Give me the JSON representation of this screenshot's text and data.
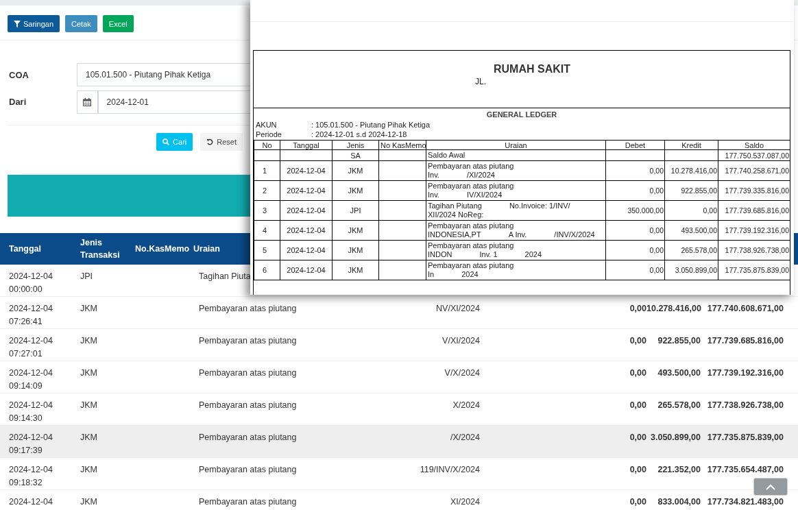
{
  "toolbar": {
    "buttons": [
      {
        "label": "Saringan",
        "kind": "filter"
      },
      {
        "label": "Cetak",
        "kind": "print"
      },
      {
        "label": "Excel",
        "kind": "excel"
      }
    ]
  },
  "filter": {
    "fields": [
      {
        "label": "COA",
        "value": "105.01.500 - Piutang Pihak Ketiga",
        "kind": "select"
      },
      {
        "label": "Dari",
        "value": "2024-12-01",
        "kind": "date"
      }
    ],
    "buttons": [
      {
        "label": "Cari",
        "kind": "search"
      },
      {
        "label": "Reset",
        "kind": "reset"
      }
    ]
  },
  "table": {
    "columns": [
      "Tanggal",
      "Jenis Transaksi",
      "No.KasMemo",
      "Uraian"
    ],
    "rows": [
      {
        "date": "2024-12-04",
        "time": "00:00:00",
        "jenis": "JPI",
        "uraian": "Tagihan Piuta",
        "highlighted": false
      },
      {
        "date": "2024-12-04",
        "time": "07:26:41",
        "jenis": "JKM",
        "uraian": "Pembayaran atas piutang",
        "tail": "NV/XI/2024",
        "debet": "0,00",
        "kredit": "10.278.416,00",
        "saldo": "177.740.608.671,00",
        "highlighted": false
      },
      {
        "date": "2024-12-04",
        "time": "07:27:01",
        "jenis": "JKM",
        "uraian": "Pembayaran atas piutang",
        "tail": "V/XI/2024",
        "debet": "0,00",
        "kredit": "922.855,00",
        "saldo": "177.739.685.816,00",
        "highlighted": false
      },
      {
        "date": "2024-12-04",
        "time": "09:14:09",
        "jenis": "JKM",
        "uraian": "Pembayaran atas piutang",
        "tail": "V/X/2024",
        "debet": "0,00",
        "kredit": "493.500,00",
        "saldo": "177.739.192.316,00",
        "highlighted": false
      },
      {
        "date": "2024-12-04",
        "time": "09:14:30",
        "jenis": "JKM",
        "uraian": "Pembayaran atas piutang",
        "tail": "X/2024",
        "debet": "0,00",
        "kredit": "265.578,00",
        "saldo": "177.738.926.738,00",
        "highlighted": false
      },
      {
        "date": "2024-12-04",
        "time": "09:17:39",
        "jenis": "JKM",
        "uraian": "Pembayaran atas piutang",
        "tail": "/X/2024",
        "debet": "0,00",
        "kredit": "3.050.899,00",
        "saldo": "177.735.875.839,00",
        "highlighted": true
      },
      {
        "date": "2024-12-04",
        "time": "09:18:32",
        "jenis": "JKM",
        "uraian": "Pembayaran atas piutang",
        "tail": "119/INV/X/2024",
        "debet": "0,00",
        "kredit": "221.352,00",
        "saldo": "177.735.654.487,00",
        "highlighted": false
      },
      {
        "date": "2024-12-04",
        "jenis": "JKM",
        "uraian": "Pembayaran atas piutang",
        "tail": "XI/2024",
        "debet": "0,00",
        "kredit": "833.004,00",
        "saldo": "177.734.821.483,00",
        "highlighted": false
      }
    ]
  },
  "report": {
    "title": "RUMAH SAKIT",
    "address": "JL.",
    "heading": "GENERAL LEDGER",
    "meta": [
      {
        "label": "AKUN",
        "value": ": 105.01.500 - Piutang Pihak Ketiga"
      },
      {
        "label": "Periode",
        "value": ": 2024-12-01 s.d 2024-12-18"
      }
    ],
    "columns": [
      "No",
      "Tanggal",
      "Jenis",
      "No KasMemo",
      "Uraian",
      "Debet",
      "Kredit",
      "Saldo"
    ],
    "rows": [
      {
        "jenis": "SA",
        "lines": [
          [
            "Saldo Awal"
          ]
        ],
        "saldo": "177.750.537.087,00"
      },
      {
        "no": "1",
        "tanggal": "2024-12-04",
        "jenis": "JKM",
        "lines": [
          [
            "Pembayaran atas piutang"
          ],
          [
            "Inv.",
            "/XI/2024"
          ]
        ],
        "debet": "0,00",
        "kredit": "10.278.416,00",
        "saldo": "177.740.258.671,00"
      },
      {
        "no": "2",
        "tanggal": "2024-12-04",
        "jenis": "JKM",
        "lines": [
          [
            "Pembayaran atas piutang"
          ],
          [
            "Inv.",
            "IV/XI/2024"
          ]
        ],
        "debet": "0,00",
        "kredit": "922.855,00",
        "saldo": "177.739.335.816,00"
      },
      {
        "no": "3",
        "tanggal": "2024-12-04",
        "jenis": "JPI",
        "lines": [
          [
            "Tagihan Piutang",
            "No.Invoice: 1/INV/"
          ],
          [
            "XII/2024 NoReg:"
          ]
        ],
        "debet": "350.000,00",
        "kredit": "0,00",
        "saldo": "177.739.685.816,00"
      },
      {
        "no": "4",
        "tanggal": "2024-12-04",
        "jenis": "JKM",
        "lines": [
          [
            "Pembayaran atas piutang"
          ],
          [
            "INDONESIA,PT",
            "A Inv.",
            "/INV/X/2024"
          ]
        ],
        "debet": "0,00",
        "kredit": "493.500,00",
        "saldo": "177.739.192.316,00"
      },
      {
        "no": "5",
        "tanggal": "2024-12-04",
        "jenis": "JKM",
        "lines": [
          [
            "Pembayaran atas piutang"
          ],
          [
            "INDON",
            "Inv. 1",
            "2024"
          ]
        ],
        "debet": "0,00",
        "kredit": "265.578,00",
        "saldo": "177.738.926.738,00"
      },
      {
        "no": "6",
        "tanggal": "2024-12-04",
        "jenis": "JKM",
        "lines": [
          [
            "Pembayaran atas piutang"
          ],
          [
            "In",
            "2024"
          ]
        ],
        "debet": "0,00",
        "kredit": "3.050.899,00",
        "saldo": "177.735.875.839,00"
      }
    ]
  }
}
